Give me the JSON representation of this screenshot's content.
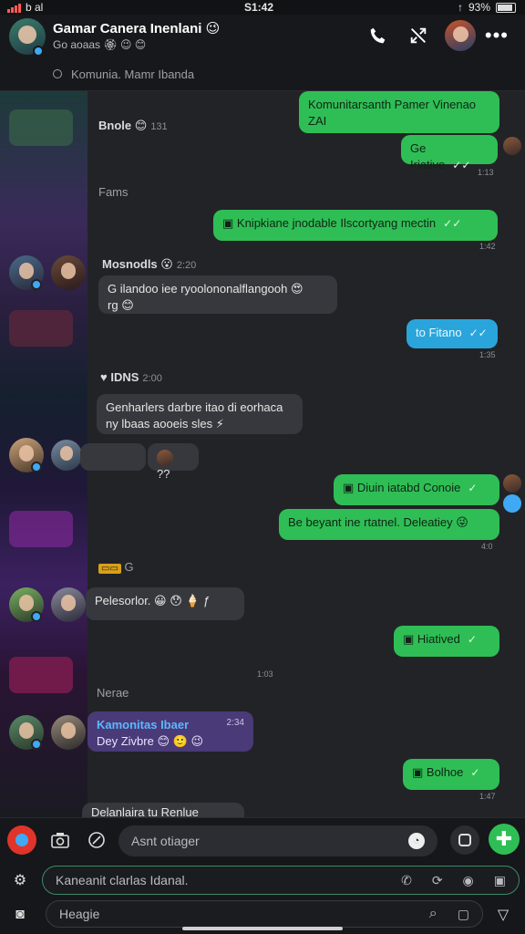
{
  "status": {
    "carrier": "b al",
    "time": "S1:42",
    "battery": "93%"
  },
  "header": {
    "title": "Gamar Canera Inenlani",
    "title_emoji": "😉",
    "subtitle": "Go aoaas",
    "subtitle_emojis": "🏵 😉 😊",
    "community": "Komunia. Mamr Ibanda",
    "icons": [
      "phone-icon",
      "expand-icon",
      "more-icon"
    ]
  },
  "messages": {
    "m1": {
      "text": "Komunitarsanth Pamer Vinenao",
      "text2": "ZAI"
    },
    "m2": {
      "text": "Ge Iriative",
      "time": "1:13"
    },
    "s1": {
      "name": "Bnole",
      "emoji": "😊",
      "time": "131"
    },
    "l1": "Fams",
    "m3": {
      "text": "Knipkiane jnodable Ilscortyang mectin",
      "time": "1:42"
    },
    "s2": {
      "name": "Mosnodls",
      "emoji": "😮",
      "time": "2:20"
    },
    "m4": {
      "text": "G ilandoo iee ryoolononalflangooh",
      "text2": "rg",
      "emoji": "😍",
      "emoji2": "😊"
    },
    "m5": {
      "text": "to Fitano",
      "time": "1:35"
    },
    "s3": {
      "name": "IDNS",
      "time": "2:00"
    },
    "m6": {
      "text": "Genharlers darbre itao di eorhaca",
      "text2": "ny lbaas aooeis sles",
      "emoji": "⚡"
    },
    "m6b": {
      "text": "??"
    },
    "m7": {
      "text": "Diuin iatabd Conoie",
      "time": ""
    },
    "m8": {
      "text": "Be beyant ine rtatnel. Deleatiey",
      "emoji": "😜",
      "time": "4:0"
    },
    "l2": "G",
    "m9": {
      "text": "Pelesorlor.",
      "emoji": "😀 😯 🍦 ƒ"
    },
    "m10": {
      "text": "Hiatived",
      "time": ""
    },
    "m10b": {
      "time": "1:03"
    },
    "l3": "Nerae",
    "m11": {
      "name": "Kamonitas Ibaer",
      "name_time": "2:34",
      "text": "Dey Zivbre",
      "emoji": "😊 🙂 😉"
    },
    "m12": {
      "text": "Bolhoe",
      "time": "1:47"
    },
    "m13": {
      "text": "Delanlaira tu Renlue"
    }
  },
  "composer": {
    "placeholder": "Asnt otiager",
    "field2": "Kaneanit clarlas Idanal.",
    "field3": "Heagie"
  },
  "colors": {
    "outgoing": "#2fbe55",
    "incoming": "#37383d",
    "accent_blue": "#2aa5dc",
    "purple": "#4a3a77"
  }
}
